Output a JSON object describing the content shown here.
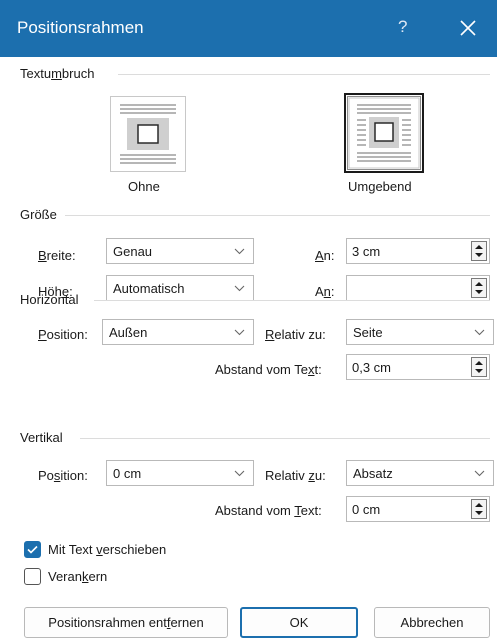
{
  "dialog": {
    "title": "Positionsrahmen",
    "help": "?"
  },
  "wrap": {
    "section": [
      "Textu",
      "m",
      "bruch"
    ],
    "none_label": "Ohne",
    "around_label": "Umgebend"
  },
  "size": {
    "section": "Größe",
    "width_label": [
      "",
      "B",
      "reite:"
    ],
    "width_value": "Genau",
    "height_label": [
      "Höh",
      "e",
      ":"
    ],
    "height_value": "Automatisch",
    "at1_label": [
      "",
      "A",
      "n:"
    ],
    "at1_value": "3 cm",
    "at2_label": [
      "A",
      "n",
      ":"
    ],
    "at2_value": ""
  },
  "horizontal": {
    "section": "Horizontal",
    "position_label": [
      "",
      "P",
      "osition:"
    ],
    "position_value": "Außen",
    "relative_label": [
      "",
      "R",
      "elativ zu:"
    ],
    "relative_value": "Seite",
    "distance_label": [
      "Abstand vom Te",
      "x",
      "t:"
    ],
    "distance_value": "0,3 cm"
  },
  "vertical": {
    "section": "Vertikal",
    "position_label": [
      "Po",
      "s",
      "ition:"
    ],
    "position_value": "0 cm",
    "relative_label": [
      "Relativ ",
      "z",
      "u:"
    ],
    "relative_value": "Absatz",
    "distance_label": [
      "Abstand vom ",
      "T",
      "ext:"
    ],
    "distance_value": "0 cm"
  },
  "options": {
    "move_with_text": [
      "Mit Text ",
      "v",
      "erschieben"
    ],
    "move_with_text_checked": true,
    "lock_anchor": [
      "Veran",
      "k",
      "ern"
    ],
    "lock_anchor_checked": false
  },
  "buttons": {
    "remove": [
      "Positionsrahmen ent",
      "f",
      "ernen"
    ],
    "ok": "OK",
    "cancel": "Abbrechen"
  },
  "colors": {
    "accent": "#1c6fae",
    "border": "#b9b9b9"
  }
}
